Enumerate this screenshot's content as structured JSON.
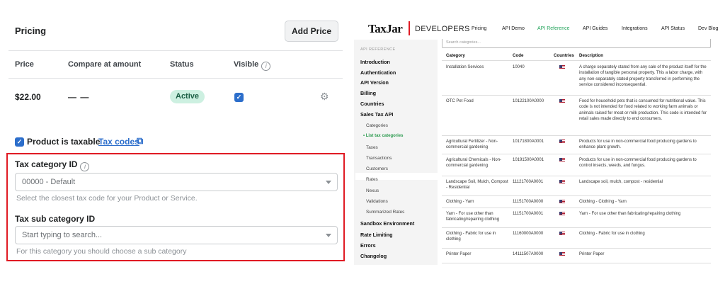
{
  "left": {
    "title": "Pricing",
    "add_price_label": "Add Price",
    "headers": {
      "price": "Price",
      "compare": "Compare at amount",
      "status": "Status",
      "visible": "Visible"
    },
    "row": {
      "price": "$22.00",
      "compare": "— —",
      "status": "Active"
    },
    "taxable_label": "Product is taxable",
    "tax_codes_link": "Tax codes",
    "tax_category": {
      "label": "Tax category ID",
      "value": "00000 - Default",
      "help": "Select the closest tax code for your Product or Service."
    },
    "tax_sub_category": {
      "label": "Tax sub category ID",
      "placeholder": "Start typing to search...",
      "help": "For this category you should choose a sub category"
    },
    "colors": {
      "accent": "#2c6ecb",
      "highlight": "#e01b24",
      "badge_bg": "#cdf0e1"
    }
  },
  "right": {
    "logo": "TaxJar",
    "logo_sub": "DEVELOPERS",
    "nav": [
      "Pricing",
      "API Demo",
      "API Reference",
      "API Guides",
      "Integrations",
      "API Status",
      "Dev Blog"
    ],
    "active_nav": "API Reference",
    "sidebar": {
      "caption": "API REFERENCE",
      "items": [
        {
          "label": "Introduction",
          "kind": "main"
        },
        {
          "label": "Authentication",
          "kind": "main"
        },
        {
          "label": "API Version",
          "kind": "main"
        },
        {
          "label": "Billing",
          "kind": "main"
        },
        {
          "label": "Countries",
          "kind": "main"
        },
        {
          "label": "Sales Tax API",
          "kind": "main"
        },
        {
          "label": "Categories",
          "kind": "sub"
        },
        {
          "label": "• List tax categories",
          "kind": "current"
        },
        {
          "label": "Taxes",
          "kind": "sub"
        },
        {
          "label": "Transactions",
          "kind": "sub"
        },
        {
          "label": "Customers",
          "kind": "sub"
        },
        {
          "label": "Rates",
          "kind": "sub"
        },
        {
          "label": "Nexus",
          "kind": "sub"
        },
        {
          "label": "Validations",
          "kind": "sub"
        },
        {
          "label": "Summarized Rates",
          "kind": "sub"
        },
        {
          "label": "Sandbox Environment",
          "kind": "main"
        },
        {
          "label": "Rate Limiting",
          "kind": "main"
        },
        {
          "label": "Errors",
          "kind": "main"
        },
        {
          "label": "Changelog",
          "kind": "main"
        }
      ]
    },
    "search_placeholder": "Search categories...",
    "table": {
      "headers": {
        "category": "Category",
        "code": "Code",
        "countries": "Countries",
        "description": "Description"
      },
      "rows": [
        {
          "category": "Installation Services",
          "code": "10040",
          "description": "A charge separately stated from any sale of the product itself for the installation of tangible personal property. This a labor charge, with any non-separately stated property transferred in performing the service considered inconsequential."
        },
        {
          "category": "OTC Pet Food",
          "code": "10122100A0000",
          "description": "Food for household pets that is consumed for nutritional value. This code is not intended for food related to working farm animals or animals raised for meat or milk production. This code is intended for retail sales made directly to end consumers."
        },
        {
          "category": "Agricultural Fertilizer - Non-commercial gardening",
          "code": "10171800A0001",
          "description": "Products for use in non-commercial food producing gardens to enhance plant growth."
        },
        {
          "category": "Agricultural Chemicals - Non-commercial gardening",
          "code": "10191500A0001",
          "description": "Products for use in non-commercial food producing gardens to control insects, weeds, and fungus."
        },
        {
          "category": "Landscape Soil, Mulch, Compost - Residential",
          "code": "11121700A0001",
          "description": "Landscape soil, mulch, compost - residential"
        },
        {
          "category": "Clothing - Yarn",
          "code": "11151700A0000",
          "description": "Clothing - Clothing - Yarn"
        },
        {
          "category": "Yarn - For use other than fabricating/repairing clothing",
          "code": "11151700A0001",
          "description": "Yarn - For use other than fabricating/repairing clothing"
        },
        {
          "category": "Clothing - Fabric for use in clothing",
          "code": "11160000A0000",
          "description": "Clothing - Fabric for use in clothing"
        },
        {
          "category": "Printer Paper",
          "code": "14111507A0000",
          "description": "Printer Paper"
        }
      ]
    }
  }
}
